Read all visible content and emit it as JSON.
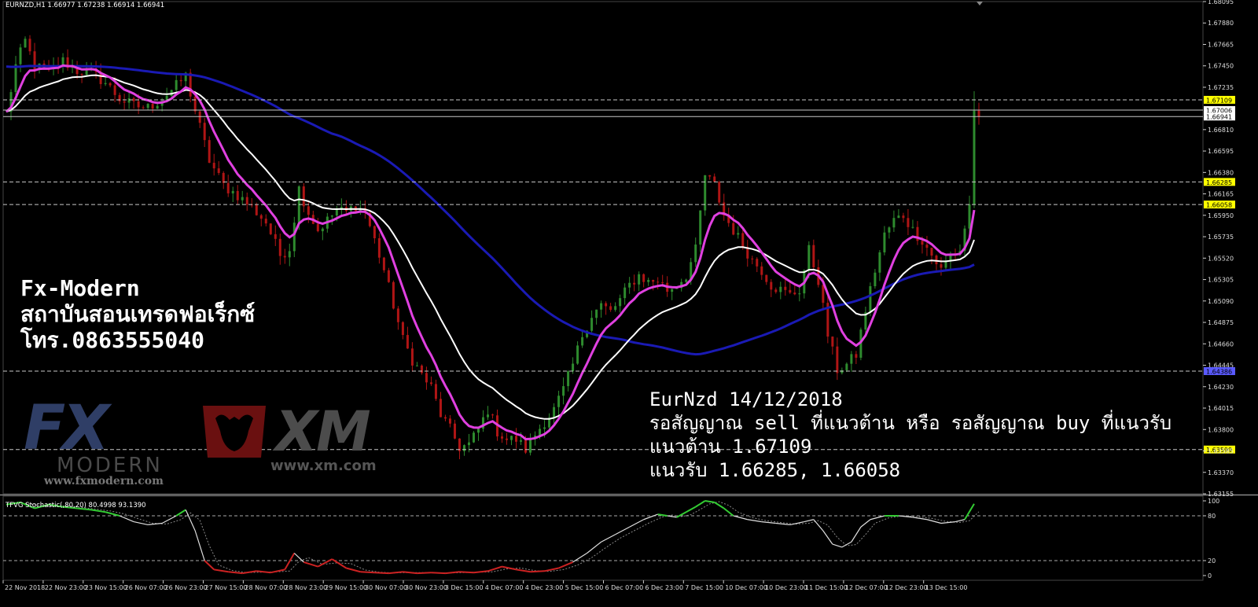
{
  "window": {
    "symbol_header": "EURNZD,H1 1.66977 1.67238 1.66914 1.66941",
    "oscillator_header": "TFVG Stochastic(,80,20) 80.4998 93.1390"
  },
  "overlay": {
    "brand_line1": "Fx-Modern",
    "brand_line2": "สถาบันสอนเทรดฟอเร็กซ์",
    "brand_line3": "โทร.0863555040",
    "analysis_line1": "EurNzd 14/12/2018",
    "analysis_line2": "รอสัญญาณ sell ที่แนวต้าน หรือ รอสัญญาณ buy ที่แนวรับ",
    "analysis_line3": "แนวต้าน 1.67109",
    "analysis_line4": "แนวรับ  1.66285, 1.66058"
  },
  "logos": {
    "fx_logo": "FX",
    "fx_sub": "MODERN",
    "fx_url": "www.fxmodern.com",
    "xm_logo": "XM",
    "xm_url": "www.xm.com"
  },
  "colors": {
    "background": "#000000",
    "bull_candle": "#2e8b2e",
    "bear_candle": "#b01515",
    "ma_fast": "#e040e0",
    "ma_mid": "#ffffff",
    "ma_slow": "#1a1ab4",
    "hline": "#c8c8c8",
    "stoch_high": "#33cc33",
    "stoch_low": "#cc2222",
    "stoch_mid": "#e0e0e0"
  },
  "chart_data": [
    {
      "type": "candlestick",
      "title": "EURNZD,H1",
      "ylim": [
        1.63155,
        1.68095
      ],
      "y_ticks": [
        "1.68095",
        "1.67880",
        "1.67665",
        "1.67450",
        "1.67235",
        "1.67109",
        "1.67006",
        "1.66941",
        "1.66810",
        "1.66595",
        "1.66380",
        "1.66285",
        "1.66165",
        "1.66058",
        "1.65950",
        "1.65735",
        "1.65520",
        "1.65305",
        "1.65090",
        "1.64875",
        "1.64660",
        "1.64445",
        "1.64386",
        "1.64230",
        "1.64015",
        "1.63800",
        "1.63599",
        "1.63585",
        "1.63370",
        "1.63155"
      ],
      "highlighted_levels": [
        {
          "label": "1.67109",
          "value": 1.67109,
          "style": "dashed",
          "tag": "yellow"
        },
        {
          "label": "1.67006",
          "value": 1.67006,
          "style": "solid",
          "tag": "white"
        },
        {
          "label": "1.66941",
          "value": 1.66941,
          "style": "solid",
          "tag": "white"
        },
        {
          "label": "1.66285",
          "value": 1.66285,
          "style": "dashed",
          "tag": "yellow"
        },
        {
          "label": "1.66058",
          "value": 1.66058,
          "style": "dashed",
          "tag": "yellow"
        },
        {
          "label": "1.64386",
          "value": 1.64386,
          "style": "dashed",
          "tag": "blue"
        },
        {
          "label": "1.63599",
          "value": 1.63599,
          "style": "dashed",
          "tag": "yellow"
        }
      ],
      "x_labels": [
        "22 Nov 2018",
        "22 Nov 23:00",
        "23 Nov 15:00",
        "26 Nov 07:00",
        "26 Nov 23:00",
        "27 Nov 15:00",
        "28 Nov 07:00",
        "28 Nov 23:00",
        "29 Nov 15:00",
        "30 Nov 07:00",
        "30 Nov 23:00",
        "3 Dec 15:00",
        "4 Dec 07:00",
        "4 Dec 23:00",
        "5 Dec 15:00",
        "6 Dec 07:00",
        "6 Dec 23:00",
        "7 Dec 15:00",
        "10 Dec 07:00",
        "10 Dec 23:00",
        "11 Dec 15:00",
        "12 Dec 07:00",
        "12 Dec 23:00",
        "13 Dec 15:00"
      ],
      "close_path": [
        [
          0,
          1.6697
        ],
        [
          2,
          1.6745
        ],
        [
          4,
          1.677
        ],
        [
          6,
          1.6745
        ],
        [
          9,
          1.6738
        ],
        [
          12,
          1.675
        ],
        [
          15,
          1.674
        ],
        [
          18,
          1.6738
        ],
        [
          21,
          1.6728
        ],
        [
          24,
          1.6712
        ],
        [
          27,
          1.6705
        ],
        [
          30,
          1.6703
        ],
        [
          33,
          1.6712
        ],
        [
          36,
          1.6725
        ],
        [
          38,
          1.6735
        ],
        [
          40,
          1.67
        ],
        [
          43,
          1.665
        ],
        [
          46,
          1.6625
        ],
        [
          49,
          1.6615
        ],
        [
          52,
          1.6603
        ],
        [
          55,
          1.6588
        ],
        [
          58,
          1.6555
        ],
        [
          60,
          1.6562
        ],
        [
          62,
          1.6622
        ],
        [
          64,
          1.6598
        ],
        [
          66,
          1.658
        ],
        [
          68,
          1.659
        ],
        [
          70,
          1.66
        ],
        [
          72,
          1.6598
        ],
        [
          74,
          1.6605
        ],
        [
          76,
          1.6598
        ],
        [
          78,
          1.657
        ],
        [
          80,
          1.654
        ],
        [
          82,
          1.6505
        ],
        [
          84,
          1.647
        ],
        [
          86,
          1.645
        ],
        [
          88,
          1.6435
        ],
        [
          90,
          1.6422
        ],
        [
          92,
          1.6395
        ],
        [
          94,
          1.638
        ],
        [
          96,
          1.6362
        ],
        [
          98,
          1.6365
        ],
        [
          100,
          1.638
        ],
        [
          102,
          1.64
        ],
        [
          104,
          1.6378
        ],
        [
          106,
          1.637
        ],
        [
          108,
          1.637
        ],
        [
          110,
          1.636
        ],
        [
          112,
          1.6375
        ],
        [
          114,
          1.6388
        ],
        [
          116,
          1.64
        ],
        [
          118,
          1.642
        ],
        [
          120,
          1.6445
        ],
        [
          122,
          1.6475
        ],
        [
          124,
          1.6495
        ],
        [
          126,
          1.6505
        ],
        [
          128,
          1.6498
        ],
        [
          130,
          1.651
        ],
        [
          132,
          1.6525
        ],
        [
          134,
          1.6535
        ],
        [
          136,
          1.6528
        ],
        [
          138,
          1.653
        ],
        [
          140,
          1.652
        ],
        [
          142,
          1.6525
        ],
        [
          144,
          1.6535
        ],
        [
          146,
          1.656
        ],
        [
          148,
          1.6635
        ],
        [
          150,
          1.6625
        ],
        [
          152,
          1.6595
        ],
        [
          154,
          1.658
        ],
        [
          156,
          1.6565
        ],
        [
          158,
          1.655
        ],
        [
          160,
          1.654
        ],
        [
          162,
          1.6525
        ],
        [
          164,
          1.652
        ],
        [
          166,
          1.6515
        ],
        [
          168,
          1.652
        ],
        [
          170,
          1.656
        ],
        [
          172,
          1.653
        ],
        [
          174,
          1.6475
        ],
        [
          176,
          1.644
        ],
        [
          178,
          1.6445
        ],
        [
          180,
          1.6455
        ],
        [
          182,
          1.65
        ],
        [
          184,
          1.654
        ],
        [
          186,
          1.6575
        ],
        [
          188,
          1.659
        ],
        [
          190,
          1.6595
        ],
        [
          192,
          1.658
        ],
        [
          194,
          1.657
        ],
        [
          196,
          1.6555
        ],
        [
          198,
          1.654
        ],
        [
          200,
          1.6555
        ],
        [
          202,
          1.656
        ],
        [
          204,
          1.6605
        ],
        [
          205,
          1.67
        ],
        [
          206,
          1.6694
        ]
      ],
      "series": [
        {
          "name": "",
          "kind": "ma_fast"
        },
        {
          "name": "",
          "kind": "ma_mid"
        },
        {
          "name": "",
          "kind": "ma_slow"
        }
      ]
    },
    {
      "type": "line",
      "title": "TFVG Stochastic(,80,20) 80.4998 93.1390",
      "ylim": [
        0,
        100
      ],
      "y_ticks": [
        "100",
        "80",
        "20",
        "0"
      ],
      "levels": [
        80,
        20
      ],
      "main_path": [
        [
          0,
          95
        ],
        [
          3,
          98
        ],
        [
          6,
          90
        ],
        [
          9,
          95
        ],
        [
          12,
          92
        ],
        [
          15,
          90
        ],
        [
          18,
          88
        ],
        [
          21,
          85
        ],
        [
          24,
          80
        ],
        [
          27,
          72
        ],
        [
          30,
          68
        ],
        [
          33,
          70
        ],
        [
          36,
          80
        ],
        [
          38,
          88
        ],
        [
          40,
          60
        ],
        [
          42,
          20
        ],
        [
          44,
          8
        ],
        [
          47,
          5
        ],
        [
          50,
          3
        ],
        [
          53,
          6
        ],
        [
          56,
          4
        ],
        [
          59,
          8
        ],
        [
          61,
          30
        ],
        [
          63,
          18
        ],
        [
          66,
          12
        ],
        [
          69,
          22
        ],
        [
          72,
          10
        ],
        [
          75,
          5
        ],
        [
          78,
          4
        ],
        [
          81,
          3
        ],
        [
          84,
          5
        ],
        [
          87,
          3
        ],
        [
          90,
          4
        ],
        [
          93,
          3
        ],
        [
          96,
          5
        ],
        [
          99,
          4
        ],
        [
          102,
          6
        ],
        [
          105,
          12
        ],
        [
          108,
          8
        ],
        [
          111,
          5
        ],
        [
          114,
          6
        ],
        [
          117,
          10
        ],
        [
          120,
          18
        ],
        [
          123,
          30
        ],
        [
          126,
          45
        ],
        [
          129,
          55
        ],
        [
          132,
          65
        ],
        [
          135,
          75
        ],
        [
          138,
          82
        ],
        [
          140,
          80
        ],
        [
          142,
          78
        ],
        [
          144,
          85
        ],
        [
          146,
          92
        ],
        [
          148,
          100
        ],
        [
          150,
          98
        ],
        [
          152,
          90
        ],
        [
          154,
          80
        ],
        [
          157,
          75
        ],
        [
          160,
          72
        ],
        [
          163,
          70
        ],
        [
          166,
          68
        ],
        [
          169,
          72
        ],
        [
          171,
          75
        ],
        [
          173,
          60
        ],
        [
          175,
          42
        ],
        [
          177,
          38
        ],
        [
          179,
          45
        ],
        [
          181,
          65
        ],
        [
          183,
          75
        ],
        [
          186,
          80
        ],
        [
          189,
          80
        ],
        [
          192,
          78
        ],
        [
          195,
          75
        ],
        [
          198,
          70
        ],
        [
          201,
          72
        ],
        [
          203,
          75
        ],
        [
          205,
          96
        ]
      ]
    }
  ]
}
